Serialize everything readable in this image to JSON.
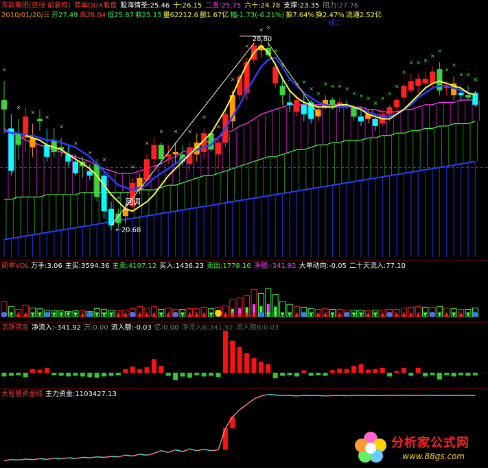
{
  "header": {
    "stock": "东软集团(日线 前复权)",
    "indicator": "简单DDX看盘",
    "sentiment": "股海情圣:25.46",
    "ma10": "十:26.15",
    "ma25": "二五:25.75",
    "ma60": "六十:24.78",
    "support": "支撑:23.35",
    "resistance": "阻力:27.76",
    "line2": {
      "date": "2010/01/20/三",
      "open": "开27.49",
      "high": "高28.04",
      "low": "低25.87",
      "close": "收25.15",
      "volume": "量62212.6",
      "amount": "额1.67亿",
      "change": "幅-1.73(-6.21%)",
      "amplitude": "振7.64%",
      "turnover": "换2.47%",
      "float": "流通2.52亿"
    },
    "hidden_label": "线二"
  },
  "annotations": {
    "high_mark": "28.80",
    "low_mark": "20.68",
    "pullback": "回调"
  },
  "vol_panel": {
    "title": "简单VOL",
    "wanshou": "万手:3.06",
    "zhumai": "主买:3594.36",
    "zhumai2": "主卖:4107.12",
    "buy": "买入:1436.23",
    "sell": "卖出:1778.16",
    "net": "净额:-341.92",
    "big_order": "大单动向:-0.05",
    "inflow20": "二十天流入:77.10"
  },
  "active_panel": {
    "title": "活跃资金",
    "net_inflow": "净流入:-341.92",
    "wan": "万:0.00",
    "inflow_amt": "流入额:-0.03",
    "yi": "亿:0.00",
    "overlay1": "净流入B:341.92",
    "overlay2": "流入额B:0.03"
  },
  "capital_panel": {
    "title": "大智慧资金线",
    "main_capital": "主力资金:1103427.13"
  },
  "watermark": {
    "title": "分析家公式网",
    "url": "www.88gs.com"
  },
  "colors": {
    "up": "#ff2020",
    "down": "#00ffff",
    "ma_yellow": "#ffff40",
    "ma_blue": "#2a3fff",
    "ma_pink": "#ff3cff",
    "green_line": "#40ff40",
    "orange": "#ff9a00",
    "green_body": "#3cd23c"
  },
  "chart_data": {
    "type": "candlestick",
    "price_range": [
      20.0,
      29.5
    ],
    "candles": [
      {
        "o": 25.8,
        "h": 27.0,
        "l": 24.8,
        "c": 26.2,
        "k": "g"
      },
      {
        "o": 25.0,
        "h": 25.6,
        "l": 23.0,
        "c": 23.2,
        "k": "c"
      },
      {
        "o": 24.3,
        "h": 25.4,
        "l": 23.7,
        "c": 24.8,
        "k": "g"
      },
      {
        "o": 24.6,
        "h": 25.9,
        "l": 24.0,
        "c": 25.5,
        "k": "r"
      },
      {
        "o": 24.6,
        "h": 25.2,
        "l": 23.8,
        "c": 24.2,
        "k": "o"
      },
      {
        "o": 25.4,
        "h": 25.8,
        "l": 24.9,
        "c": 25.3,
        "k": "g"
      },
      {
        "o": 24.3,
        "h": 25.0,
        "l": 23.6,
        "c": 23.8,
        "k": "c"
      },
      {
        "o": 24.5,
        "h": 25.0,
        "l": 23.8,
        "c": 24.0,
        "k": "g"
      },
      {
        "o": 24.2,
        "h": 24.6,
        "l": 23.8,
        "c": 24.1,
        "k": "g"
      },
      {
        "o": 23.9,
        "h": 24.3,
        "l": 23.4,
        "c": 23.6,
        "k": "c"
      },
      {
        "o": 23.6,
        "h": 23.9,
        "l": 23.0,
        "c": 23.1,
        "k": "c"
      },
      {
        "o": 23.4,
        "h": 23.8,
        "l": 22.9,
        "c": 23.6,
        "k": "g"
      },
      {
        "o": 23.2,
        "h": 23.5,
        "l": 22.8,
        "c": 23.0,
        "k": "c"
      },
      {
        "o": 23.5,
        "h": 23.7,
        "l": 21.9,
        "c": 22.1,
        "k": "g"
      },
      {
        "o": 23.0,
        "h": 23.2,
        "l": 21.2,
        "c": 21.5,
        "k": "c"
      },
      {
        "o": 21.6,
        "h": 21.9,
        "l": 20.7,
        "c": 20.9,
        "k": "c"
      },
      {
        "o": 21.0,
        "h": 21.6,
        "l": 20.8,
        "c": 21.4,
        "k": "g"
      },
      {
        "o": 21.3,
        "h": 21.8,
        "l": 21.0,
        "c": 21.6,
        "k": "o"
      },
      {
        "o": 21.7,
        "h": 22.9,
        "l": 21.5,
        "c": 22.7,
        "k": "r"
      },
      {
        "o": 22.4,
        "h": 23.1,
        "l": 22.2,
        "c": 22.9,
        "k": "o"
      },
      {
        "o": 22.8,
        "h": 23.9,
        "l": 22.6,
        "c": 23.7,
        "k": "r"
      },
      {
        "o": 23.7,
        "h": 24.6,
        "l": 23.3,
        "c": 24.3,
        "k": "r"
      },
      {
        "o": 24.3,
        "h": 24.4,
        "l": 23.5,
        "c": 23.7,
        "k": "g"
      },
      {
        "o": 23.8,
        "h": 24.3,
        "l": 23.5,
        "c": 23.9,
        "k": "r"
      },
      {
        "o": 23.9,
        "h": 24.4,
        "l": 23.5,
        "c": 24.0,
        "k": "o"
      },
      {
        "o": 23.9,
        "h": 24.3,
        "l": 23.4,
        "c": 23.6,
        "k": "g"
      },
      {
        "o": 23.5,
        "h": 24.4,
        "l": 23.2,
        "c": 24.2,
        "k": "r"
      },
      {
        "o": 23.9,
        "h": 24.8,
        "l": 23.6,
        "c": 24.4,
        "k": "o"
      },
      {
        "o": 24.0,
        "h": 25.0,
        "l": 23.7,
        "c": 24.8,
        "k": "r"
      },
      {
        "o": 24.8,
        "h": 24.9,
        "l": 24.0,
        "c": 24.1,
        "k": "g"
      },
      {
        "o": 23.9,
        "h": 24.6,
        "l": 23.3,
        "c": 24.4,
        "k": "r"
      },
      {
        "o": 24.4,
        "h": 25.8,
        "l": 24.2,
        "c": 25.6,
        "k": "r"
      },
      {
        "o": 25.3,
        "h": 26.6,
        "l": 25.0,
        "c": 26.4,
        "k": "o"
      },
      {
        "o": 26.4,
        "h": 27.3,
        "l": 26.2,
        "c": 27.2,
        "k": "r"
      },
      {
        "o": 26.5,
        "h": 28.0,
        "l": 26.2,
        "c": 27.8,
        "k": "r"
      },
      {
        "o": 27.9,
        "h": 28.8,
        "l": 27.7,
        "c": 28.5,
        "k": "r"
      },
      {
        "o": 28.5,
        "h": 28.7,
        "l": 28.0,
        "c": 28.3,
        "k": "o"
      },
      {
        "o": 28.4,
        "h": 28.8,
        "l": 28.0,
        "c": 28.1,
        "k": "g"
      },
      {
        "o": 27.6,
        "h": 27.8,
        "l": 26.7,
        "c": 26.9,
        "k": "r"
      },
      {
        "o": 26.8,
        "h": 27.2,
        "l": 26.0,
        "c": 26.4,
        "k": "g"
      },
      {
        "o": 26.1,
        "h": 26.6,
        "l": 25.7,
        "c": 26.0,
        "k": "c"
      },
      {
        "o": 25.7,
        "h": 26.4,
        "l": 25.5,
        "c": 26.2,
        "k": "r"
      },
      {
        "o": 26.0,
        "h": 26.5,
        "l": 25.3,
        "c": 25.6,
        "k": "c"
      },
      {
        "o": 26.1,
        "h": 26.2,
        "l": 25.2,
        "c": 25.4,
        "k": "c"
      },
      {
        "o": 25.5,
        "h": 26.0,
        "l": 25.3,
        "c": 25.8,
        "k": "o"
      },
      {
        "o": 25.9,
        "h": 26.4,
        "l": 25.8,
        "c": 26.2,
        "k": "o"
      },
      {
        "o": 26.2,
        "h": 26.3,
        "l": 25.8,
        "c": 26.0,
        "k": "g"
      },
      {
        "o": 25.9,
        "h": 26.3,
        "l": 25.7,
        "c": 26.1,
        "k": "r"
      },
      {
        "o": 26.0,
        "h": 26.2,
        "l": 25.8,
        "c": 26.0,
        "k": "g"
      },
      {
        "o": 25.9,
        "h": 26.0,
        "l": 25.3,
        "c": 25.5,
        "k": "g"
      },
      {
        "o": 25.5,
        "h": 25.9,
        "l": 25.1,
        "c": 25.3,
        "k": "c"
      },
      {
        "o": 25.4,
        "h": 25.8,
        "l": 25.2,
        "c": 25.6,
        "k": "o"
      },
      {
        "o": 25.4,
        "h": 25.6,
        "l": 24.9,
        "c": 25.1,
        "k": "c"
      },
      {
        "o": 25.2,
        "h": 25.8,
        "l": 25.1,
        "c": 25.6,
        "k": "r"
      },
      {
        "o": 25.6,
        "h": 26.0,
        "l": 25.3,
        "c": 25.9,
        "k": "r"
      },
      {
        "o": 25.9,
        "h": 26.3,
        "l": 25.7,
        "c": 26.2,
        "k": "r"
      },
      {
        "o": 26.3,
        "h": 26.9,
        "l": 26.1,
        "c": 26.8,
        "k": "r"
      },
      {
        "o": 26.6,
        "h": 27.3,
        "l": 26.5,
        "c": 27.0,
        "k": "r"
      },
      {
        "o": 26.8,
        "h": 27.3,
        "l": 26.5,
        "c": 27.1,
        "k": "r"
      },
      {
        "o": 27.1,
        "h": 27.4,
        "l": 26.7,
        "c": 26.9,
        "k": "r"
      },
      {
        "o": 26.9,
        "h": 27.6,
        "l": 26.7,
        "c": 27.4,
        "k": "r"
      },
      {
        "o": 27.5,
        "h": 27.8,
        "l": 26.4,
        "c": 26.6,
        "k": "g"
      },
      {
        "o": 26.7,
        "h": 27.0,
        "l": 26.4,
        "c": 26.8,
        "k": "r"
      },
      {
        "o": 26.9,
        "h": 27.2,
        "l": 26.2,
        "c": 26.4,
        "k": "o"
      },
      {
        "o": 26.4,
        "h": 26.8,
        "l": 26.2,
        "c": 26.5,
        "k": "c"
      },
      {
        "o": 26.4,
        "h": 26.8,
        "l": 26.2,
        "c": 26.3,
        "k": "g"
      },
      {
        "o": 26.5,
        "h": 26.6,
        "l": 25.9,
        "c": 26.0,
        "k": "c"
      }
    ],
    "ma_yellow": [
      null,
      null,
      null,
      24.7,
      24.6,
      24.5,
      24.3,
      24.2,
      24.1,
      23.9,
      23.7,
      23.5,
      23.3,
      23.0,
      22.6,
      22.2,
      21.9,
      21.6,
      21.5,
      21.7,
      21.9,
      22.2,
      22.6,
      23.0,
      23.3,
      23.6,
      23.9,
      24.2,
      24.5,
      24.8,
      25.3,
      25.8,
      26.4,
      27.1,
      27.7,
      28.2,
      28.5,
      28.2,
      27.7,
      27.1,
      26.6,
      26.3,
      26.1,
      26.0,
      25.9,
      25.9,
      25.9,
      26.0,
      26.0,
      25.9,
      25.8,
      25.6,
      25.5,
      25.4,
      25.4,
      25.6,
      25.8,
      26.1,
      26.4,
      26.7,
      26.9,
      27.0,
      26.9,
      26.8,
      26.7,
      26.5,
      26.4
    ],
    "ma_blue": [
      24.9,
      24.8,
      24.8,
      24.7,
      24.7,
      24.6,
      24.5,
      24.5,
      24.4,
      24.3,
      24.2,
      24.0,
      23.8,
      23.5,
      23.2,
      22.9,
      22.6,
      22.5,
      22.4,
      22.5,
      22.6,
      22.9,
      23.1,
      23.3,
      23.5,
      23.7,
      23.9,
      24.1,
      24.2,
      24.3,
      24.6,
      25.0,
      25.5,
      26.0,
      26.6,
      27.1,
      27.6,
      27.9,
      28.0,
      27.6,
      27.1,
      26.8,
      26.5,
      26.3,
      26.1,
      26.0,
      25.9,
      25.9,
      25.9,
      25.9,
      25.8,
      25.7,
      25.6,
      25.5,
      25.5,
      25.6,
      25.8,
      26.0,
      26.3,
      26.5,
      26.7,
      26.8,
      26.8,
      26.7,
      26.6,
      26.5,
      26.4
    ],
    "ma_pink": [
      25.0,
      24.8,
      24.7,
      24.5,
      24.4,
      24.3,
      24.2,
      24.1,
      24.0,
      23.9,
      23.8,
      23.7,
      23.6,
      23.4,
      23.3,
      23.2,
      23.1,
      23.1,
      23.1,
      23.2,
      23.3,
      23.4,
      23.5,
      23.7,
      23.8,
      24.0,
      24.1,
      24.2,
      24.4,
      24.5,
      24.6,
      24.8,
      24.9,
      25.1,
      25.2,
      25.4,
      25.6,
      25.7,
      25.8,
      25.9,
      26.0,
      26.0,
      26.0,
      26.0,
      26.0,
      26.0,
      26.0,
      26.0,
      25.9,
      25.9,
      25.9,
      25.8,
      25.8,
      25.7,
      25.7,
      25.7,
      25.8,
      25.8,
      25.9,
      26.0,
      26.0,
      26.1,
      26.1,
      26.1,
      26.2,
      26.2,
      26.2
    ],
    "ma_green": [
      22.0,
      22.0,
      22.1,
      22.1,
      22.1,
      22.1,
      22.2,
      22.2,
      22.2,
      22.2,
      22.2,
      22.3,
      22.3,
      22.3,
      22.3,
      22.3,
      22.3,
      22.3,
      22.3,
      22.4,
      22.4,
      22.4,
      22.5,
      22.6,
      22.6,
      22.7,
      22.8,
      22.9,
      23.0,
      23.0,
      23.1,
      23.2,
      23.3,
      23.4,
      23.5,
      23.6,
      23.7,
      23.8,
      23.8,
      23.9,
      24.0,
      24.1,
      24.1,
      24.2,
      24.3,
      24.3,
      24.4,
      24.4,
      24.5,
      24.5,
      24.5,
      24.6,
      24.6,
      24.7,
      24.7,
      24.8,
      24.8,
      24.9,
      24.9,
      25.0,
      25.0,
      25.1,
      25.1,
      25.2,
      25.2,
      25.2,
      25.3
    ],
    "ma_navy": [
      20.3,
      20.35,
      20.4,
      20.45,
      20.5,
      20.55,
      20.6,
      20.65,
      20.7,
      20.75,
      20.8,
      20.85,
      20.9,
      20.95,
      21.0,
      21.05,
      21.1,
      21.15,
      21.2,
      21.25,
      21.3,
      21.35,
      21.4,
      21.45,
      21.5,
      21.55,
      21.6,
      21.65,
      21.7,
      21.75,
      21.8,
      21.85,
      21.9,
      21.95,
      22.0,
      22.05,
      22.1,
      22.15,
      22.2,
      22.25,
      22.3,
      22.35,
      22.4,
      22.45,
      22.5,
      22.55,
      22.6,
      22.65,
      22.7,
      22.75,
      22.8,
      22.85,
      22.9,
      22.95,
      23.0,
      23.05,
      23.1,
      23.15,
      23.2,
      23.25,
      23.3,
      23.35,
      23.4,
      23.45,
      23.5,
      23.55,
      23.6
    ],
    "volume": [
      2.1,
      1.4,
      1.0,
      1.6,
      1.2,
      1.1,
      0.9,
      0.8,
      0.8,
      0.7,
      0.8,
      0.8,
      0.7,
      1.1,
      1.0,
      0.9,
      0.8,
      0.9,
      1.1,
      1.4,
      1.2,
      1.4,
      1.0,
      1.2,
      1.0,
      1.0,
      1.1,
      1.1,
      1.3,
      1.1,
      1.3,
      1.5,
      2.4,
      2.6,
      2.9,
      3.8,
      3.2,
      3.9,
      3.1,
      2.1,
      1.7,
      1.4,
      1.3,
      1.1,
      1.0,
      1.1,
      1.0,
      1.0,
      0.9,
      0.9,
      0.9,
      0.8,
      0.9,
      0.9,
      1.0,
      1.0,
      1.2,
      1.3,
      1.4,
      1.3,
      1.3,
      1.4,
      1.2,
      1.1,
      1.0,
      1.0,
      1.2
    ],
    "active_flow": [
      -0.3,
      -0.25,
      -0.2,
      -0.35,
      0.3,
      0.25,
      0.4,
      -0.2,
      -0.25,
      -0.3,
      -0.25,
      -0.3,
      -0.35,
      -0.4,
      -0.3,
      -0.25,
      -0.2,
      0.3,
      0.5,
      0.3,
      0.45,
      1.1,
      0.55,
      -0.25,
      -0.6,
      -0.3,
      -0.4,
      -0.2,
      -0.3,
      -0.25,
      -0.35,
      3.4,
      2.6,
      2.1,
      1.6,
      1.2,
      0.9,
      0.7,
      -0.45,
      -0.25,
      -0.2,
      -0.3,
      0.2,
      -0.25,
      -0.2,
      -0.25,
      0.2,
      0.35,
      0.3,
      0.55,
      0.7,
      0.25,
      0.3,
      0.4,
      -0.3,
      0.15,
      0.4,
      -0.25,
      0.4,
      -0.3,
      -0.2,
      -0.55,
      -0.2,
      -0.3,
      -0.2,
      -0.25,
      -0.2
    ],
    "capital_line": [
      0.0,
      0.1,
      0.05,
      0.15,
      0.1,
      0.2,
      0.12,
      0.25,
      0.18,
      0.3,
      0.22,
      0.35,
      0.3,
      0.4,
      0.35,
      0.45,
      0.4,
      0.6,
      0.5,
      0.7,
      0.6,
      0.8,
      1.1,
      0.9,
      1.2,
      1.0,
      1.3,
      1.1,
      1.25,
      1.1,
      1.2,
      3.6,
      4.9,
      5.7,
      6.3,
      6.9,
      7.25,
      7.4,
      7.35,
      7.3,
      7.3,
      7.25,
      7.3,
      7.28,
      7.3,
      7.25,
      7.28,
      7.3,
      7.27,
      7.3,
      7.32,
      7.3,
      7.28,
      7.3,
      7.32,
      7.3,
      7.32,
      7.3,
      7.3,
      7.33,
      7.31,
      7.3,
      7.32,
      7.3,
      7.3,
      7.31,
      7.3
    ]
  }
}
